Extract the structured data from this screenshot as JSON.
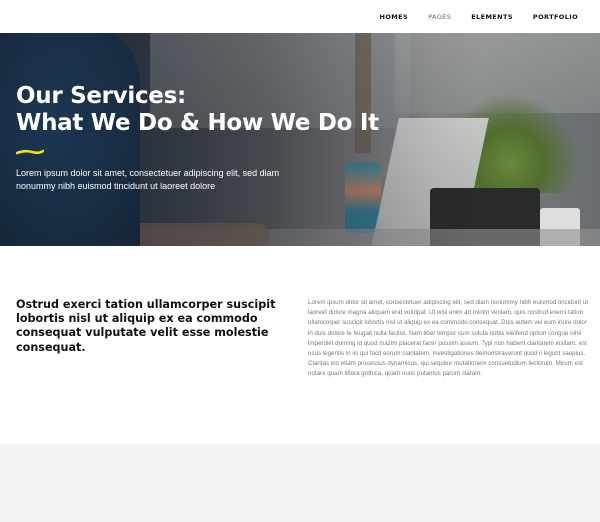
{
  "nav": {
    "items": [
      {
        "label": "HOMES",
        "active": false
      },
      {
        "label": "PAGES",
        "active": true
      },
      {
        "label": "ELEMENTS",
        "active": false
      },
      {
        "label": "PORTFOLIO",
        "active": false
      }
    ]
  },
  "hero": {
    "title_line1": "Our Services:",
    "title_line2": "What We Do & How We Do It",
    "subtitle": "Lorem ipsum dolor sit amet, consectetuer adipiscing elit, sed diam nonummy nibh euismod tincidunt ut laoreet dolore",
    "accent_color": "#f5e400"
  },
  "intro": {
    "heading": "Ostrud exerci tation ullamcorper suscipit lobortis nisl ut aliquip ex ea commodo consequat vulputate velit esse molestie consequat.",
    "body": "Lorem ipsum dolor sit amet, consectetuer adipiscing elit, sed diam nonummy nibh euismod tincidunt ut laoreet dolore magna aliquam erat volutpat. Ut wisi enim ad minim veniam, quis nostrud exerci tation ullamcorper suscipit lobortis nisl ut aliquip ex ea commodo consequat. Duis autem vel eum iriure dolor in duis dolore te feugait nulla facilisi. Nam liber tempor cum soluta nobis eleifend option congue nihil imperdiet doming id quod mazim placerat facer possim assum. Typi non habent claritatem insitam, est usus legentis in iis qui facit eorum claritatem. Investigationes demonstraverunt quod ii legunt saepius. Claritas est etiam processus dynamicus, qui sequitur mutationem consuetudium lectorum. Mirum est notare quam littera gothica, quam nunc putamus parum claram."
  }
}
